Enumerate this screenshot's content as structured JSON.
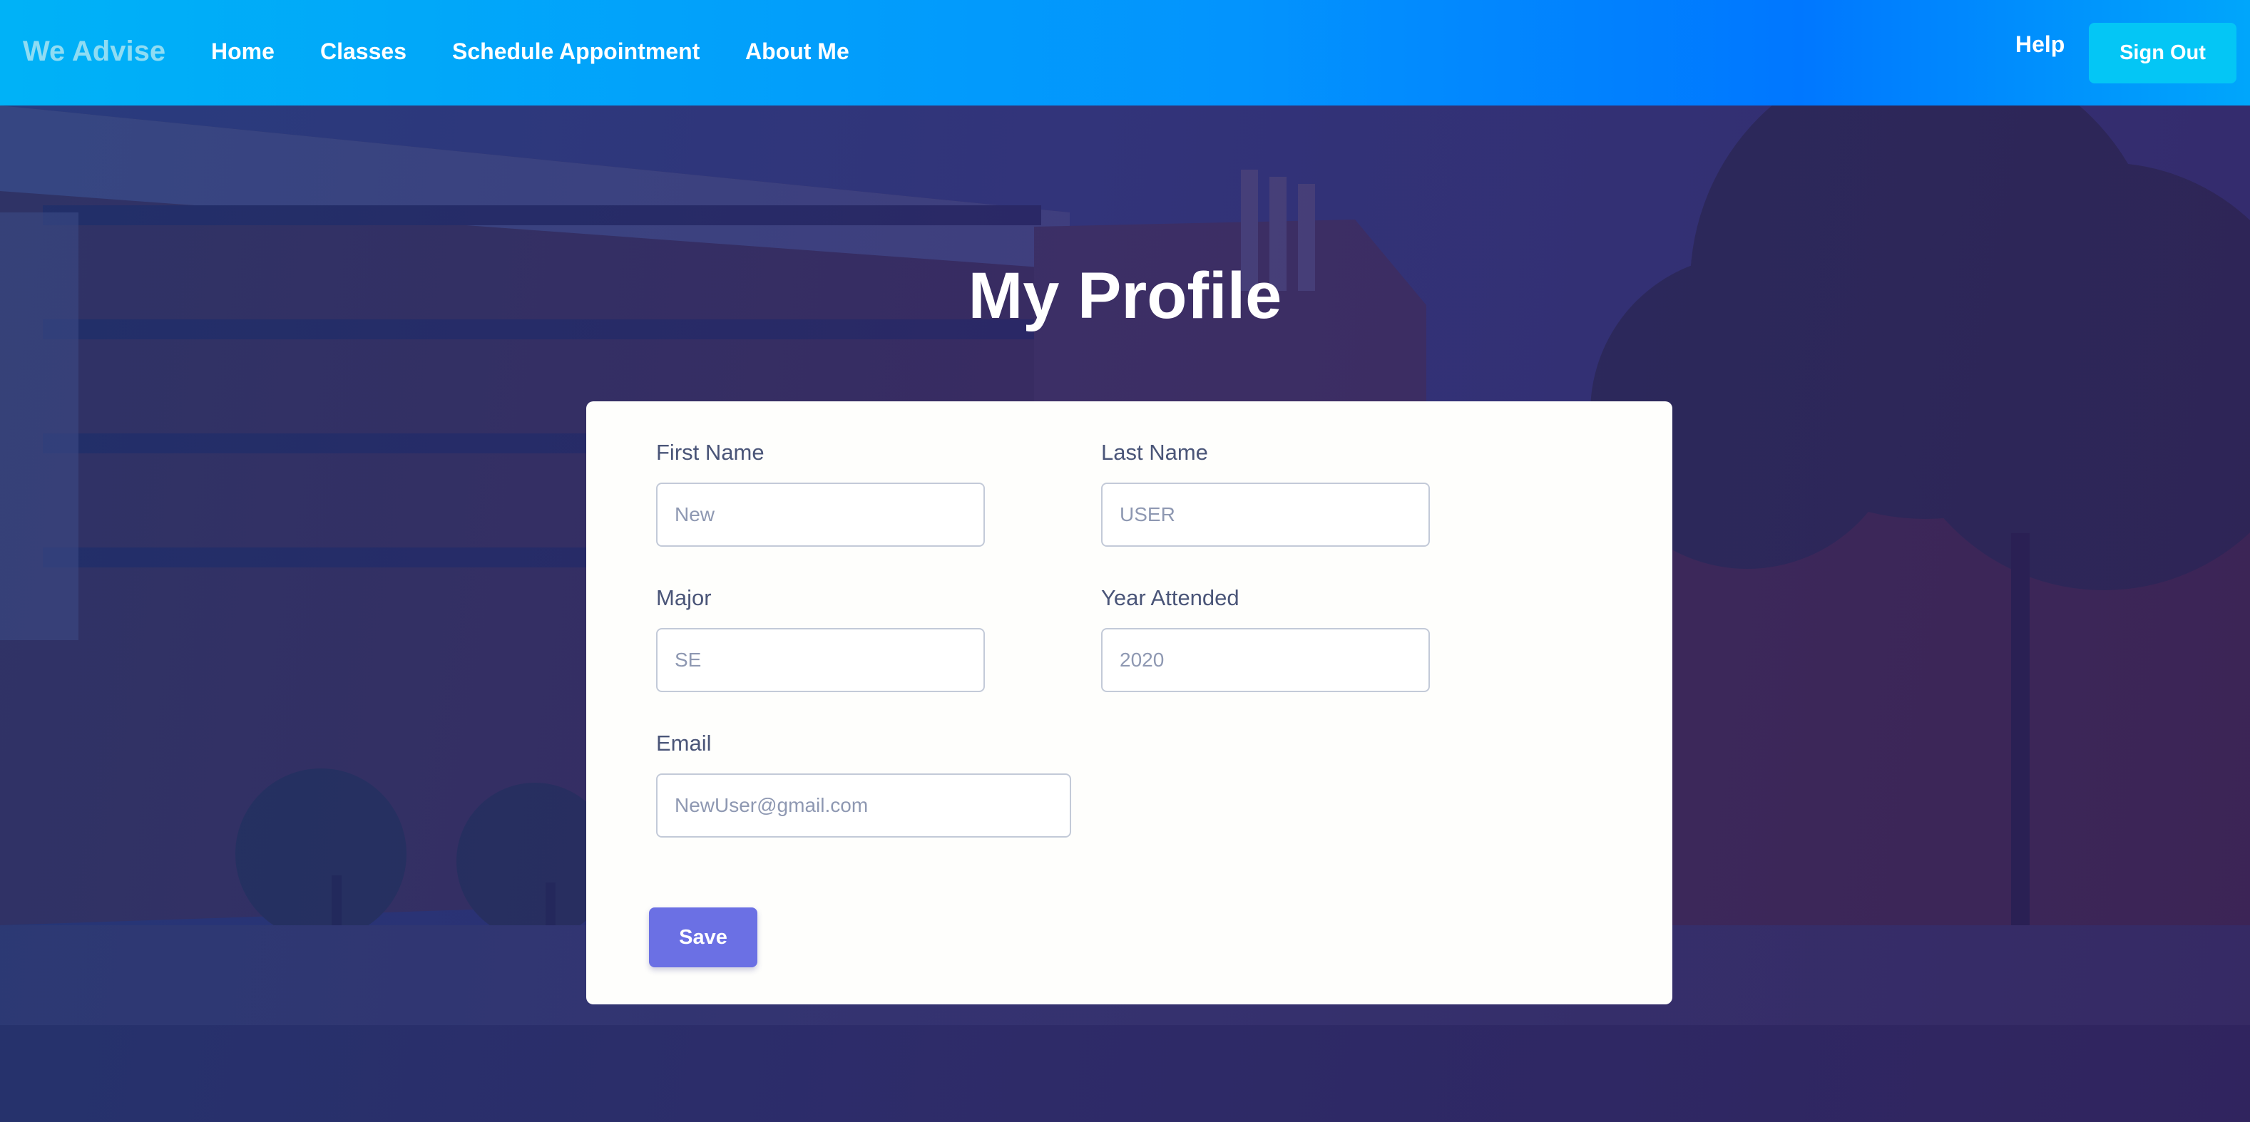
{
  "brand": "We Advise",
  "nav": {
    "links": [
      "Home",
      "Classes",
      "Schedule Appointment",
      "About Me"
    ],
    "help": "Help",
    "sign_out": "Sign Out"
  },
  "title": "My Profile",
  "form": {
    "first_name": {
      "label": "First Name",
      "placeholder": "New"
    },
    "last_name": {
      "label": "Last Name",
      "placeholder": "USER"
    },
    "major": {
      "label": "Major",
      "placeholder": "SE"
    },
    "year": {
      "label": "Year Attended",
      "placeholder": "2020"
    },
    "email": {
      "label": "Email",
      "placeholder": "NewUser@gmail.com"
    },
    "save": "Save"
  },
  "colors": {
    "navbar_start": "#00b2f7",
    "navbar_end": "#0077ff",
    "sign_out_bg": "#04c6f5",
    "save_bg": "#6b70e4",
    "overlay": "#2a2369"
  }
}
